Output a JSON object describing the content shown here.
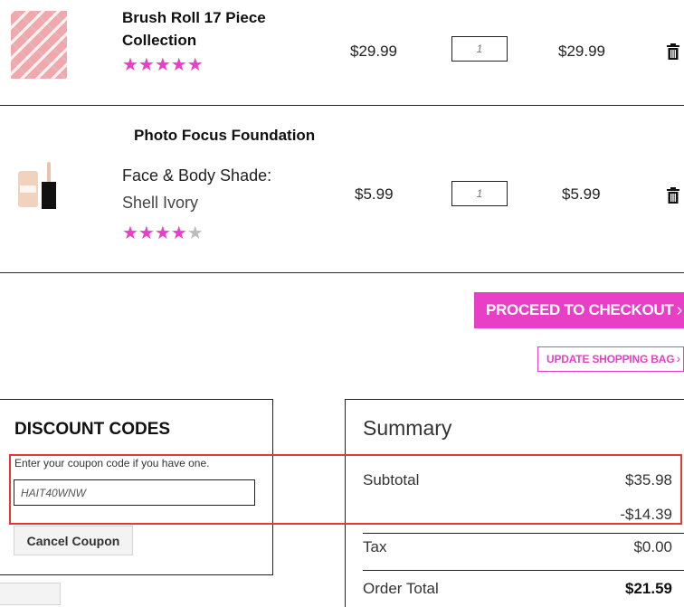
{
  "cart": {
    "items": [
      {
        "name_line1": "Brush Roll 17 Piece",
        "name_line2": "Collection",
        "rating_stars": "★★★★★",
        "rating_empty": "",
        "price": "$29.99",
        "quantity": "1",
        "total": "$29.99"
      },
      {
        "name_line1": "Photo Focus Foundation",
        "attribute_label": "Face & Body Shade:",
        "attribute_value": "Shell Ivory",
        "rating_stars": "★★★★",
        "rating_empty": "★",
        "price": "$5.99",
        "quantity": "1",
        "total": "$5.99"
      }
    ]
  },
  "actions": {
    "checkout_label": "PROCEED TO CHECKOUT",
    "update_label": "UPDATE SHOPPING BAG",
    "chevron": "›"
  },
  "discount": {
    "title": "DISCOUNT CODES",
    "hint": "Enter your coupon code if you have one.",
    "code_value": "HAIT40WNW",
    "cancel_label": "Cancel Coupon"
  },
  "summary": {
    "title": "Summary",
    "subtotal_label": "Subtotal",
    "subtotal_value": "$35.98",
    "discount_value": "-$14.39",
    "tax_label": "Tax",
    "tax_value": "$0.00",
    "order_total_label": "Order Total",
    "order_total_value": "$21.59"
  },
  "colors": {
    "accent": "#e93fc6",
    "highlight": "#e53935"
  }
}
